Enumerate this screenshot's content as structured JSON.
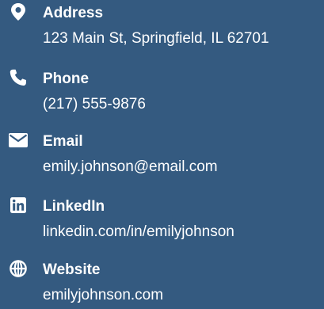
{
  "contact": {
    "items": [
      {
        "icon": "location-pin-icon",
        "label": "Address",
        "value": "123 Main St, Springfield, IL 62701"
      },
      {
        "icon": "phone-icon",
        "label": "Phone",
        "value": "(217) 555-9876"
      },
      {
        "icon": "envelope-icon",
        "label": "Email",
        "value": "emily.johnson@email.com"
      },
      {
        "icon": "linkedin-icon",
        "label": "LinkedIn",
        "value": "linkedin.com/in/emilyjohnson"
      },
      {
        "icon": "globe-icon",
        "label": "Website",
        "value": "emilyjohnson.com"
      }
    ]
  },
  "colors": {
    "background": "#345a80",
    "text": "#ffffff"
  }
}
